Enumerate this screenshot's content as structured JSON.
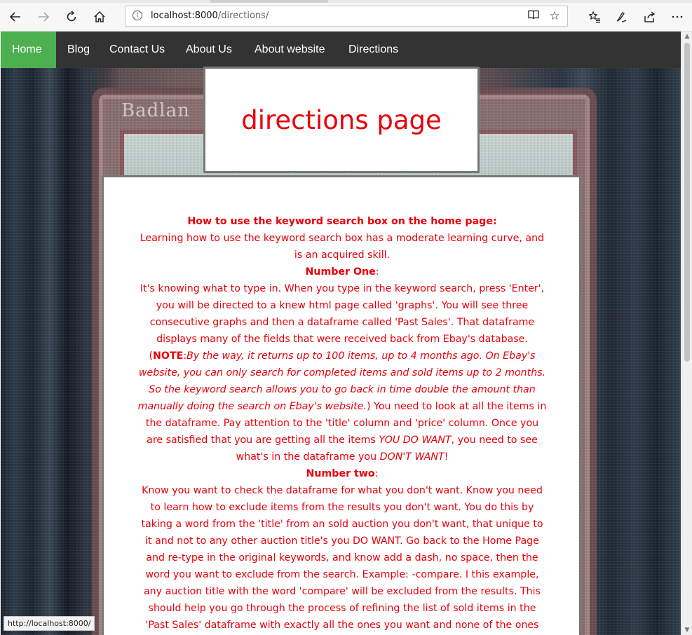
{
  "browser": {
    "url_host": "localhost:8000",
    "url_path": "/directions/",
    "status_url": "http://localhost:8000/"
  },
  "icons": {
    "back": "back-arrow-icon",
    "forward": "forward-arrow-icon",
    "refresh": "refresh-icon",
    "home": "home-icon",
    "info": "site-info-icon",
    "reader": "reading-view-icon",
    "favorite": "favorite-star-icon",
    "favorites_list": "favorites-list-icon",
    "pen": "pen-icon",
    "share": "share-icon",
    "more": "more-dots-icon"
  },
  "nav": {
    "items": [
      "Home",
      "Blog",
      "Contact Us",
      "About Us",
      "About website",
      "Directions"
    ],
    "active_index": 0,
    "bg_color": "#333333",
    "active_color": "#4caf50"
  },
  "page": {
    "title": "directions page",
    "text_color": "#e8000b",
    "content": {
      "heading": "How to use the keyword search box on the home page:",
      "intro": "Learning how to use the keyword search box has a moderate learning curve, and is an acquired skill.",
      "step1_label": "Number One",
      "step1_text": "It's knowing what to type in. When you type in the keyword search, press 'Enter', you will be directed to a knew html page called 'graphs'. You will see three consecutive graphs and then a dataframe called 'Past Sales'. That dataframe displays many of the fields that were received back from Ebay's database.",
      "note_label": "NOTE",
      "note_text": "By the way, it returns up to 100 items, up to 4 months ago. On Ebay's website, you can only search for completed items and sold items up to 2 months. So the keyword search allows you to go back in time double the amount than manually doing the search on Ebay's website.",
      "step1_after": "You need to look at all the items in the dataframe. Pay attention to the 'title' column and 'price' column. Once you are satisfied that you are getting all the items",
      "do_want": "YOU DO WANT",
      "step1_mid": ", you need to see what's in the dataframe you",
      "dont_want": "DON'T WANT",
      "step1_end": "!",
      "step2_label": "Number two",
      "step2_text": "Know you want to check the dataframe for what you don't want. Know you need to learn how to exclude items from the results you don't want. You do this by taking a word from the 'title' from an sold auction you don't want, that unique to it and not to any other auction title's you DO WANT. Go back to the Home Page and re-type in the original keywords, and know add a dash, no space, then the word you want to exclude from the search. Example: -compare. I this example, any auction title with the word 'compare' will be excluded from the results. This should help you go through the process of refining the list of sold items in the 'Past Sales' dataframe with exactly all the ones you want and none of the ones"
    }
  }
}
